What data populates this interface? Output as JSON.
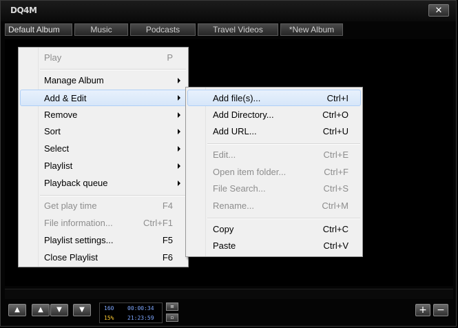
{
  "app": {
    "logo": "DQ4M",
    "close_label": "✕"
  },
  "tabs": [
    {
      "label": "Default Album"
    },
    {
      "label": "Music"
    },
    {
      "label": "Podcasts"
    },
    {
      "label": "Travel Videos"
    },
    {
      "label": "*New Album"
    }
  ],
  "context_menu": {
    "items": [
      {
        "label": "Play",
        "shortcut": "P",
        "disabled": true
      },
      {
        "label": "Manage Album",
        "submenu": true
      },
      {
        "label": "Add & Edit",
        "submenu": true,
        "highlighted": true
      },
      {
        "label": "Remove",
        "submenu": true
      },
      {
        "label": "Sort",
        "submenu": true
      },
      {
        "label": "Select",
        "submenu": true
      },
      {
        "label": "Playlist",
        "submenu": true
      },
      {
        "label": "Playback queue",
        "submenu": true
      },
      {
        "label": "Get play time",
        "shortcut": "F4",
        "disabled": true
      },
      {
        "label": "File information...",
        "shortcut": "Ctrl+F1",
        "disabled": true
      },
      {
        "label": "Playlist settings...",
        "shortcut": "F5"
      },
      {
        "label": "Close Playlist",
        "shortcut": "F6"
      }
    ]
  },
  "submenu": {
    "items": [
      {
        "label": "Add file(s)...",
        "shortcut": "Ctrl+I",
        "highlighted": true
      },
      {
        "label": "Add Directory...",
        "shortcut": "Ctrl+O"
      },
      {
        "label": "Add URL...",
        "shortcut": "Ctrl+U"
      },
      {
        "label": "Edit...",
        "shortcut": "Ctrl+E",
        "disabled": true
      },
      {
        "label": "Open item folder...",
        "shortcut": "Ctrl+F",
        "disabled": true
      },
      {
        "label": "File Search...",
        "shortcut": "Ctrl+S",
        "disabled": true
      },
      {
        "label": "Rename...",
        "shortcut": "Ctrl+M",
        "disabled": true
      },
      {
        "label": "Copy",
        "shortcut": "Ctrl+C"
      },
      {
        "label": "Paste",
        "shortcut": "Ctrl+V"
      }
    ]
  },
  "display": {
    "bitrate": "160",
    "time": "00:00:34",
    "percent": "15%",
    "clock": "21:23:59"
  },
  "controls": {
    "top_icon": "▲",
    "up_icon": "▲",
    "down_icon": "▼",
    "bottom_icon": "▼",
    "add_icon": "+",
    "remove_icon": "−"
  },
  "colors": {
    "background": "#000000",
    "menu_bg": "#f0f0f0",
    "highlight": "#d6e6f9",
    "display_blue": "#7fa8ff",
    "display_yellow": "#ffcc33"
  }
}
